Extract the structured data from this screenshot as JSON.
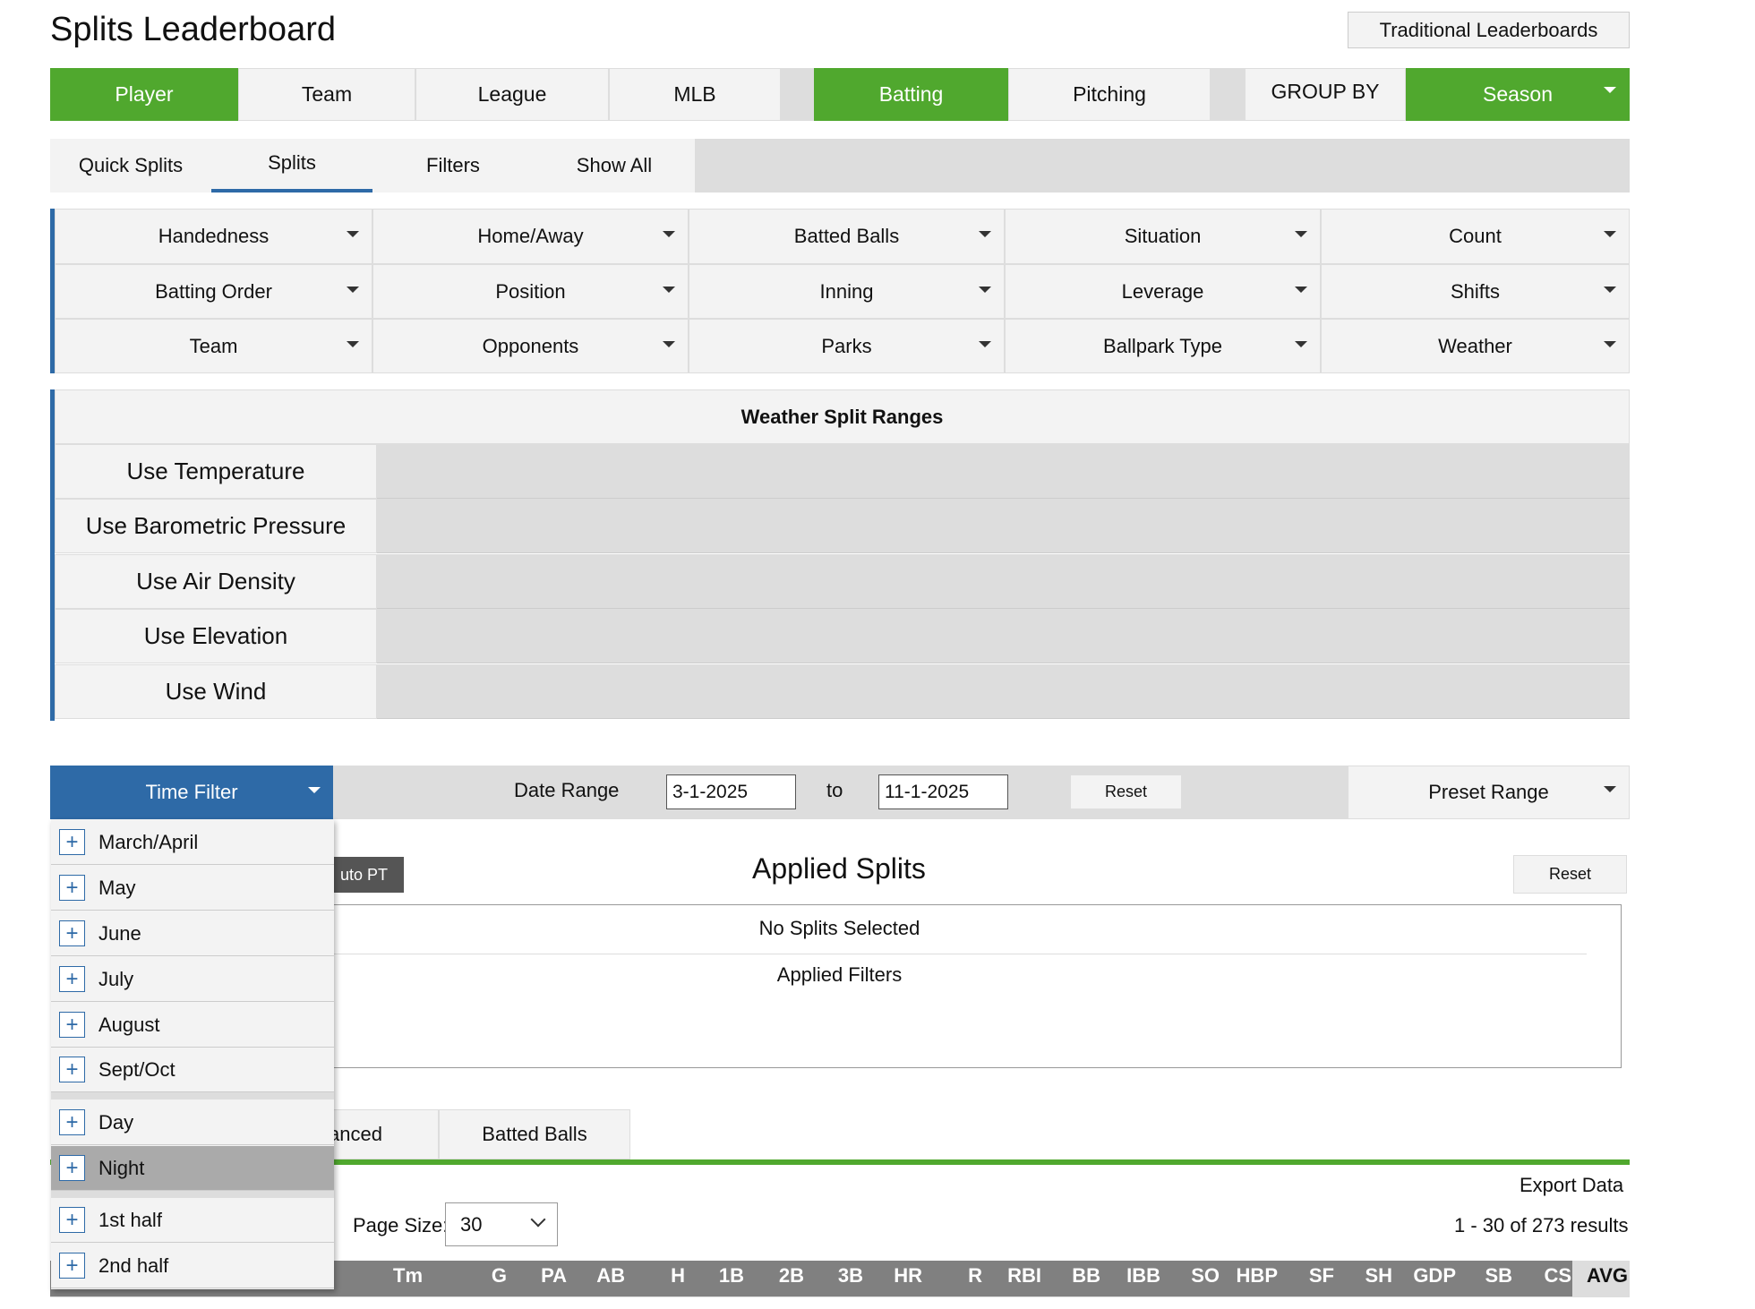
{
  "header": {
    "title": "Splits Leaderboard",
    "traditional_button": "Traditional Leaderboards"
  },
  "main_tabs": {
    "player": "Player",
    "team": "Team",
    "league": "League",
    "mlb": "MLB",
    "batting": "Batting",
    "pitching": "Pitching",
    "group_by": "GROUP BY",
    "season": "Season"
  },
  "sub_tabs": [
    "Quick Splits",
    "Splits",
    "Filters",
    "Show All"
  ],
  "split_grid": [
    [
      "Handedness",
      "Home/Away",
      "Batted Balls",
      "Situation",
      "Count"
    ],
    [
      "Batting Order",
      "Position",
      "Inning",
      "Leverage",
      "Shifts"
    ],
    [
      "Team",
      "Opponents",
      "Parks",
      "Ballpark Type",
      "Weather"
    ]
  ],
  "weather": {
    "title": "Weather Split Ranges",
    "rows": [
      "Use Temperature",
      "Use Barometric Pressure",
      "Use Air Density",
      "Use Elevation",
      "Use Wind"
    ]
  },
  "time_bar": {
    "filter_label": "Time Filter",
    "date_range_label": "Date Range",
    "start_date": "3-1-2025",
    "to_label": "to",
    "end_date": "11-1-2025",
    "reset_label": "Reset",
    "preset_label": "Preset Range"
  },
  "applied": {
    "auto_pt": "uto PT",
    "title": "Applied Splits",
    "reset_label": "Reset",
    "no_splits": "No Splits Selected",
    "filters": "Applied Filters"
  },
  "lower_tabs": {
    "advanced": "anced",
    "batted_balls": "Batted Balls"
  },
  "table_controls": {
    "export": "Export Data",
    "page_size_label": "Page Size:",
    "page_size": "30",
    "results": "1 - 30 of 273 results"
  },
  "stats_headers": [
    "Tm",
    "G",
    "PA",
    "AB",
    "H",
    "1B",
    "2B",
    "3B",
    "HR",
    "R",
    "RBI",
    "BB",
    "IBB",
    "SO",
    "HBP",
    "SF",
    "SH",
    "GDP",
    "SB",
    "CS",
    "AVG"
  ],
  "time_dropdown": {
    "months": [
      "March/April",
      "May",
      "June",
      "July",
      "August",
      "Sept/Oct"
    ],
    "day_night": [
      "Day",
      "Night"
    ],
    "halves": [
      "1st half",
      "2nd half"
    ],
    "selected": "Night"
  },
  "colors": {
    "green": "#50a82e",
    "blue": "#2e6aa7",
    "header_gray": "#808080"
  }
}
